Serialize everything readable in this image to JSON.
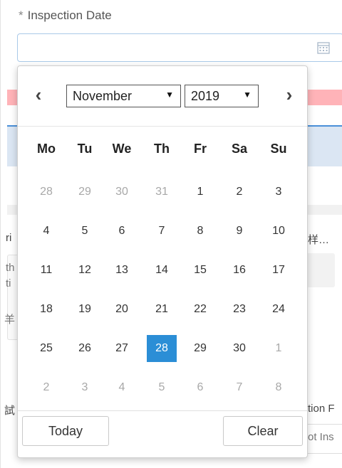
{
  "form": {
    "required_mark": "*",
    "field_label": "Inspection Date",
    "input_value": "",
    "calendar_icon": "calendar-icon",
    "side_fragments": {
      "f1": "ri",
      "f2": "th",
      "f3": "ti",
      "f4": "样…",
      "f5": "羊",
      "f6": "試",
      "f7": "tion F",
      "f8": "ot Ins"
    }
  },
  "picker": {
    "prev_icon": "chevron-left-icon",
    "prev_glyph": "‹",
    "next_icon": "chevron-right-icon",
    "next_glyph": "›",
    "month": "November",
    "year": "2019",
    "caret": "▼",
    "weekdays": [
      "Mo",
      "Tu",
      "We",
      "Th",
      "Fr",
      "Sa",
      "Su"
    ],
    "weeks": [
      [
        {
          "d": "28",
          "other": true
        },
        {
          "d": "29",
          "other": true
        },
        {
          "d": "30",
          "other": true
        },
        {
          "d": "31",
          "other": true
        },
        {
          "d": "1"
        },
        {
          "d": "2"
        },
        {
          "d": "3"
        }
      ],
      [
        {
          "d": "4"
        },
        {
          "d": "5"
        },
        {
          "d": "6"
        },
        {
          "d": "7"
        },
        {
          "d": "8"
        },
        {
          "d": "9"
        },
        {
          "d": "10"
        }
      ],
      [
        {
          "d": "11"
        },
        {
          "d": "12"
        },
        {
          "d": "13"
        },
        {
          "d": "14"
        },
        {
          "d": "15"
        },
        {
          "d": "16"
        },
        {
          "d": "17"
        }
      ],
      [
        {
          "d": "18"
        },
        {
          "d": "19"
        },
        {
          "d": "20"
        },
        {
          "d": "21"
        },
        {
          "d": "22"
        },
        {
          "d": "23"
        },
        {
          "d": "24"
        }
      ],
      [
        {
          "d": "25"
        },
        {
          "d": "26"
        },
        {
          "d": "27"
        },
        {
          "d": "28",
          "selected": true
        },
        {
          "d": "29"
        },
        {
          "d": "30"
        },
        {
          "d": "1",
          "other": true
        }
      ],
      [
        {
          "d": "2",
          "other": true
        },
        {
          "d": "3",
          "other": true
        },
        {
          "d": "4",
          "other": true
        },
        {
          "d": "5",
          "other": true
        },
        {
          "d": "6",
          "other": true
        },
        {
          "d": "7",
          "other": true
        },
        {
          "d": "8",
          "other": true
        }
      ]
    ],
    "today_label": "Today",
    "clear_label": "Clear"
  },
  "colors": {
    "selected": "#2b8ed6",
    "alert_band": "#ffb3b8",
    "header_band": "#dbe6f3",
    "input_border": "#a9c9e8"
  }
}
